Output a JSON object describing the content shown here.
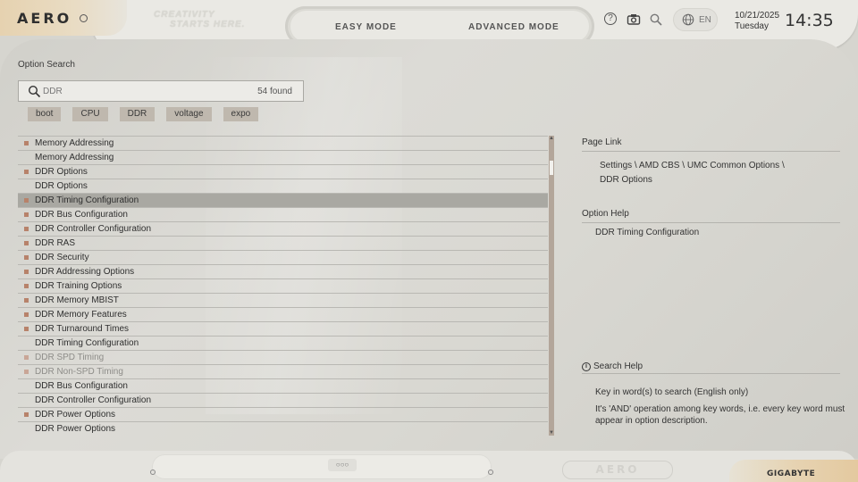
{
  "header": {
    "logo": "AERO",
    "tagline_line1": "CREATIVITY",
    "tagline_line2": "STARTS HERE.",
    "modes": {
      "easy": "EASY MODE",
      "advanced": "ADVANCED MODE"
    },
    "icons": [
      "help-icon",
      "camera-icon",
      "search-icon",
      "globe-icon"
    ],
    "language": "EN",
    "date": "10/21/2025",
    "weekday": "Tuesday",
    "time": "14:35"
  },
  "search": {
    "title": "Option Search",
    "query": "DDR",
    "found": "54 found",
    "chips": [
      "boot",
      "CPU",
      "DDR",
      "voltage",
      "expo"
    ]
  },
  "results": [
    {
      "label": "Memory Addressing",
      "bullet": true,
      "state": "normal"
    },
    {
      "label": "Memory Addressing",
      "bullet": false,
      "state": "normal"
    },
    {
      "label": "DDR Options",
      "bullet": true,
      "state": "normal"
    },
    {
      "label": "DDR Options",
      "bullet": false,
      "state": "normal"
    },
    {
      "label": "DDR Timing Configuration",
      "bullet": true,
      "state": "selected"
    },
    {
      "label": "DDR Bus Configuration",
      "bullet": true,
      "state": "normal"
    },
    {
      "label": "DDR Controller Configuration",
      "bullet": true,
      "state": "normal"
    },
    {
      "label": "DDR RAS",
      "bullet": true,
      "state": "normal"
    },
    {
      "label": "DDR Security",
      "bullet": true,
      "state": "normal"
    },
    {
      "label": "DDR Addressing Options",
      "bullet": true,
      "state": "normal"
    },
    {
      "label": "DDR Training Options",
      "bullet": true,
      "state": "normal"
    },
    {
      "label": "DDR Memory MBIST",
      "bullet": true,
      "state": "normal"
    },
    {
      "label": "DDR Memory Features",
      "bullet": true,
      "state": "normal"
    },
    {
      "label": "DDR Turnaround Times",
      "bullet": true,
      "state": "normal"
    },
    {
      "label": "DDR Timing Configuration",
      "bullet": false,
      "state": "normal"
    },
    {
      "label": "DDR SPD Timing",
      "bullet": true,
      "state": "dimmed"
    },
    {
      "label": "DDR Non-SPD Timing",
      "bullet": true,
      "state": "dimmed"
    },
    {
      "label": "DDR Bus Configuration",
      "bullet": false,
      "state": "normal"
    },
    {
      "label": "DDR Controller Configuration",
      "bullet": false,
      "state": "normal"
    },
    {
      "label": "DDR Power Options",
      "bullet": true,
      "state": "normal"
    },
    {
      "label": "DDR Power Options",
      "bullet": false,
      "state": "normal"
    }
  ],
  "right_panel": {
    "page_link_title": "Page Link",
    "page_link_path": "Settings \\ AMD CBS \\ UMC Common Options \\",
    "page_link_leaf": "DDR Options",
    "option_help_title": "Option Help",
    "option_help_text": "DDR Timing Configuration",
    "search_help_title": "Search Help",
    "search_help_line1": "Key in word(s) to search (English only)",
    "search_help_line2": "It's 'AND' operation among key words, i.e. every key word must appear in option description."
  },
  "footer": {
    "logo": "AERO",
    "brand": "GIGABYTE",
    "dots": "○○○"
  },
  "colors": {
    "accent_bullet": "#b7826a",
    "selected_row": "#a9a8a2",
    "chip_bg": "#bfb8ae",
    "gold_tab": "#e4c99f"
  }
}
